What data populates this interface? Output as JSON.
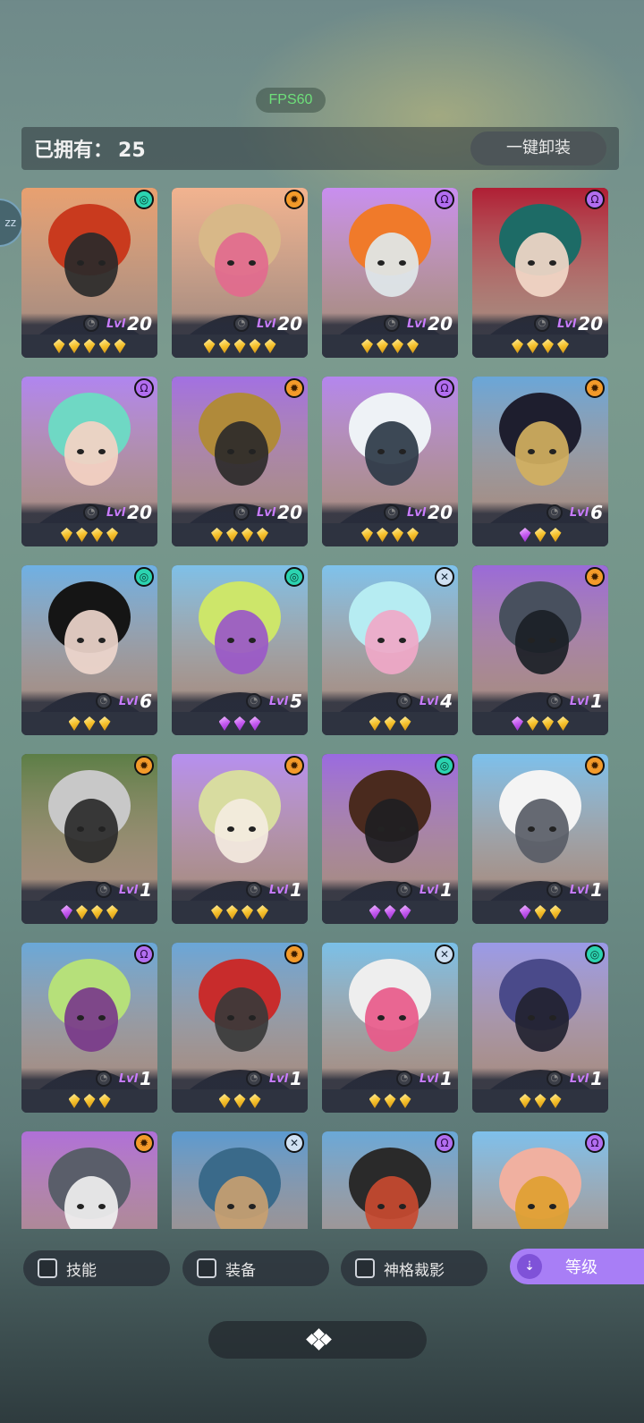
{
  "hud": {
    "fps_label": "FPS60",
    "side_tab_label": "zz"
  },
  "header": {
    "owned_label": "已拥有：",
    "owned_count": "25",
    "unequip_all_label": "一键卸装"
  },
  "heroes": [
    {
      "badge": "swirl",
      "lvl_prefix": "Lvl",
      "level": "20",
      "gems": [
        "gold",
        "gold",
        "gold",
        "gold",
        "gold"
      ],
      "palette": [
        "#e8a070",
        "#c93a1e",
        "#2a2a2a"
      ]
    },
    {
      "badge": "gear",
      "lvl_prefix": "Lvl",
      "level": "20",
      "gems": [
        "gold",
        "gold",
        "gold",
        "gold",
        "gold"
      ],
      "palette": [
        "#f2b38f",
        "#d8b888",
        "#e26a8e"
      ]
    },
    {
      "badge": "omega",
      "lvl_prefix": "Lvl",
      "level": "20",
      "gems": [
        "gold",
        "gold",
        "gold",
        "gold"
      ],
      "palette": [
        "#c88ef0",
        "#f07a2a",
        "#e0e8ea"
      ]
    },
    {
      "badge": "omega",
      "lvl_prefix": "Lvl",
      "level": "20",
      "gems": [
        "gold",
        "gold",
        "gold",
        "gold"
      ],
      "palette": [
        "#b01e34",
        "#1d6b66",
        "#f2d8c8"
      ]
    },
    {
      "badge": "omega",
      "lvl_prefix": "Lvl",
      "level": "20",
      "gems": [
        "gold",
        "gold",
        "gold",
        "gold"
      ],
      "palette": [
        "#b085f0",
        "#6fd8c4",
        "#f4d3c3"
      ]
    },
    {
      "badge": "gear",
      "lvl_prefix": "Lvl",
      "level": "20",
      "gems": [
        "gold",
        "gold",
        "gold",
        "gold"
      ],
      "palette": [
        "#a270e2",
        "#b08a3a",
        "#2d2a2a"
      ]
    },
    {
      "badge": "omega",
      "lvl_prefix": "Lvl",
      "level": "20",
      "gems": [
        "gold",
        "gold",
        "gold",
        "gold"
      ],
      "palette": [
        "#b486ee",
        "#eef2f6",
        "#2c3a46"
      ]
    },
    {
      "badge": "gear",
      "lvl_prefix": "Lvl",
      "level": "6",
      "gems": [
        "purple",
        "gold",
        "gold"
      ],
      "palette": [
        "#6aa6d8",
        "#1e1e2e",
        "#d2b060"
      ]
    },
    {
      "badge": "swirl",
      "lvl_prefix": "Lvl",
      "level": "6",
      "gems": [
        "gold",
        "gold",
        "gold"
      ],
      "palette": [
        "#6eb0e4",
        "#151515",
        "#eed6cc"
      ]
    },
    {
      "badge": "swirl",
      "lvl_prefix": "Lvl",
      "level": "5",
      "gems": [
        "purple",
        "purple",
        "purple"
      ],
      "palette": [
        "#7ec0e8",
        "#cde66a",
        "#9a58c8"
      ]
    },
    {
      "badge": "cross",
      "lvl_prefix": "Lvl",
      "level": "4",
      "gems": [
        "gold",
        "gold",
        "gold"
      ],
      "palette": [
        "#7ec2ec",
        "#b6ecf2",
        "#f0a8c8"
      ]
    },
    {
      "badge": "gear",
      "lvl_prefix": "Lvl",
      "level": "1",
      "gems": [
        "purple",
        "gold",
        "gold",
        "gold"
      ],
      "palette": [
        "#9a6ad8",
        "#48505e",
        "#1b1f26"
      ]
    },
    {
      "badge": "gear",
      "lvl_prefix": "Lvl",
      "level": "1",
      "gems": [
        "purple",
        "gold",
        "gold",
        "gold"
      ],
      "palette": [
        "#5c7e46",
        "#c8c8c8",
        "#2a2a2a"
      ]
    },
    {
      "badge": "gear",
      "lvl_prefix": "Lvl",
      "level": "1",
      "gems": [
        "gold",
        "gold",
        "gold",
        "gold"
      ],
      "palette": [
        "#b68ff0",
        "#d8dca0",
        "#f4ece0"
      ]
    },
    {
      "badge": "swirl",
      "lvl_prefix": "Lvl",
      "level": "1",
      "gems": [
        "purple",
        "purple",
        "purple"
      ],
      "palette": [
        "#9a6ae0",
        "#4a2a1e",
        "#1e1e22"
      ]
    },
    {
      "badge": "gear",
      "lvl_prefix": "Lvl",
      "level": "1",
      "gems": [
        "purple",
        "gold",
        "gold"
      ],
      "palette": [
        "#7cc0ec",
        "#f4f4f4",
        "#585c66"
      ]
    },
    {
      "badge": "omega",
      "lvl_prefix": "Lvl",
      "level": "1",
      "gems": [
        "gold",
        "gold",
        "gold"
      ],
      "palette": [
        "#6aa8d8",
        "#b6e07a",
        "#7a3a8a"
      ]
    },
    {
      "badge": "gear",
      "lvl_prefix": "Lvl",
      "level": "1",
      "gems": [
        "gold",
        "gold",
        "gold"
      ],
      "palette": [
        "#6aa6d8",
        "#c82c2c",
        "#3a3a3a"
      ]
    },
    {
      "badge": "cross",
      "lvl_prefix": "Lvl",
      "level": "1",
      "gems": [
        "gold",
        "gold",
        "gold"
      ],
      "palette": [
        "#7ac0e8",
        "#eeeeee",
        "#e85a8a"
      ]
    },
    {
      "badge": "swirl",
      "lvl_prefix": "Lvl",
      "level": "1",
      "gems": [
        "gold",
        "gold",
        "gold"
      ],
      "palette": [
        "#9a9ae8",
        "#4a4a8a",
        "#222230"
      ]
    },
    {
      "badge": "gear",
      "palette": [
        "#b070d8",
        "#5a5e6a",
        "#f0f0f0"
      ]
    },
    {
      "badge": "cross",
      "palette": [
        "#5c9ad0",
        "#3a6a8a",
        "#c8a070"
      ]
    },
    {
      "badge": "omega",
      "palette": [
        "#6aa8d8",
        "#2a2a2a",
        "#c84a30"
      ]
    },
    {
      "badge": "omega",
      "palette": [
        "#7ec0ec",
        "#f0b0a0",
        "#e0a030"
      ]
    }
  ],
  "filters": [
    {
      "label": "技能"
    },
    {
      "label": "装备"
    },
    {
      "label": "神格裁影"
    }
  ],
  "sort": {
    "label": "等级",
    "icon": "double-chevron-down-icon"
  },
  "colors": {
    "gem_gold": "#f6c12c",
    "gem_purple": "#c45af0",
    "lvl_prefix": "#c97cff",
    "sort_active": "#a87ef6"
  }
}
